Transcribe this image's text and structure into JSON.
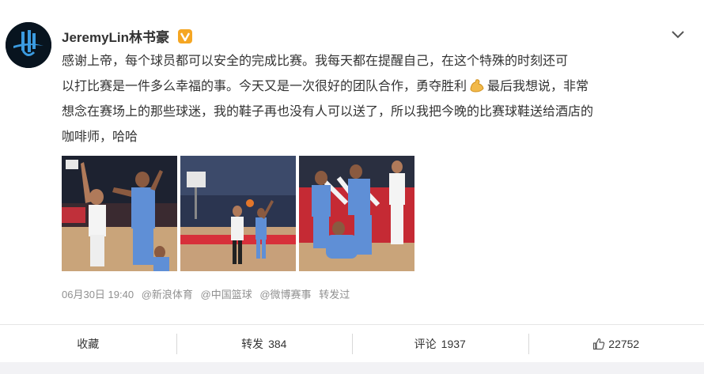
{
  "post": {
    "username": "JeremyLin林书豪",
    "verified_badge": "v-badge-icon",
    "content_lines": [
      "感谢上帝，每个球员都可以安全的完成比赛。我每天都在提醒自己，在这个特殊的时刻还可",
      "以打比赛是一件多么幸福的事。今天又是一次很好的团队合作，勇夺胜利",
      "最后我想说，非常",
      "想念在赛场上的那些球迷，我的鞋子再也没有人可以送了，所以我把今晚的比赛球鞋送给酒店的",
      "咖啡师，哈哈"
    ],
    "emoji": "flexed-biceps-icon",
    "meta": {
      "time": "06月30日 19:40",
      "mentions": [
        "@新浪体育",
        "@中国篮球",
        "@微博赛事"
      ],
      "repost_label": "转发过"
    }
  },
  "photos": [
    {
      "name": "photo-1"
    },
    {
      "name": "photo-2"
    },
    {
      "name": "photo-3"
    }
  ],
  "actions": {
    "favorite": "收藏",
    "repost_label": "转发",
    "repost_count": "384",
    "comment_label": "评论",
    "comment_count": "1937",
    "like_count": "22752"
  },
  "colors": {
    "text": "#333333",
    "meta": "#909090",
    "badge": "#f5a623",
    "jersey_blue": "#5f8fd6"
  }
}
